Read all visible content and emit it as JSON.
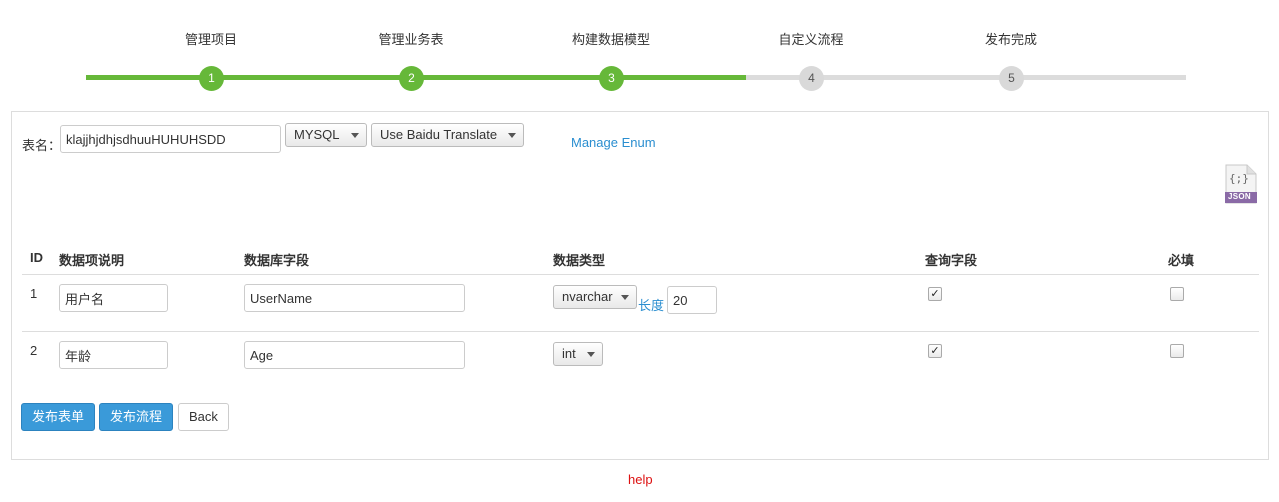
{
  "wizard": {
    "steps": [
      {
        "label": "管理项目",
        "num": "1",
        "done": true
      },
      {
        "label": "管理业务表",
        "num": "2",
        "done": true
      },
      {
        "label": "构建数据模型",
        "num": "3",
        "done": true
      },
      {
        "label": "自定义流程",
        "num": "4",
        "done": false
      },
      {
        "label": "发布完成",
        "num": "5",
        "done": false
      }
    ],
    "colors": {
      "done": "#66b839",
      "pending": "#dcdcdc"
    }
  },
  "form": {
    "table_label": "表名：",
    "table_name": "klajjhjdhjsdhuuHUHUHSDD",
    "db_select": "MYSQL",
    "translate_select": "Use Baidu Translate",
    "manage_enum": "Manage Enum",
    "json_icon_text": "JSON",
    "json_icon_glyph": "{;}"
  },
  "table": {
    "headers": {
      "id": "ID",
      "desc": "数据项说明",
      "field": "数据库字段",
      "type": "数据类型",
      "query": "查询字段",
      "required": "必填"
    },
    "rows": [
      {
        "id": "1",
        "desc": "用户名",
        "field": "UserName",
        "type": "nvarchar",
        "length_label": "长度",
        "length": "20",
        "query": true,
        "required": false
      },
      {
        "id": "2",
        "desc": "年龄",
        "field": "Age",
        "type": "int",
        "query": true,
        "required": false
      }
    ]
  },
  "actions": {
    "publish_form": "发布表单",
    "publish_flow": "发布流程",
    "back": "Back"
  },
  "footer": {
    "help": "help"
  }
}
